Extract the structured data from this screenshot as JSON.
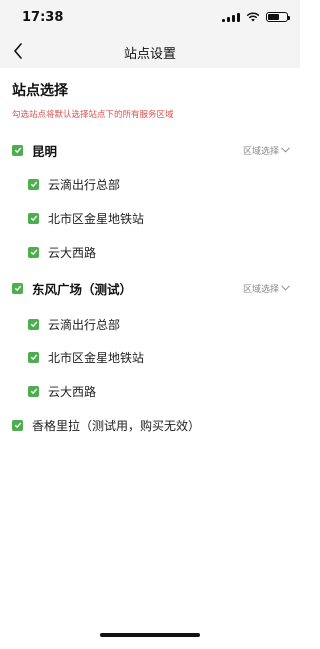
{
  "status_bar": {
    "time": "17:38"
  },
  "nav": {
    "title": "站点设置"
  },
  "page": {
    "section_title": "站点选择",
    "hint": "勾选站点将默认选择站点下的所有服务区域"
  },
  "groups": [
    {
      "name": "昆明",
      "region_select": "区域选择",
      "stations": [
        "云滴出行总部",
        "北市区金星地铁站",
        "云大西路"
      ]
    },
    {
      "name": "东风广场（测试）",
      "region_select": "区域选择",
      "stations": [
        "云滴出行总部",
        "北市区金星地铁站",
        "云大西路"
      ]
    }
  ],
  "standalone": {
    "name": "香格里拉（测试用，购买无效）"
  },
  "colors": {
    "accent_green": "#4cae4c",
    "hint_red": "#d9534f"
  }
}
